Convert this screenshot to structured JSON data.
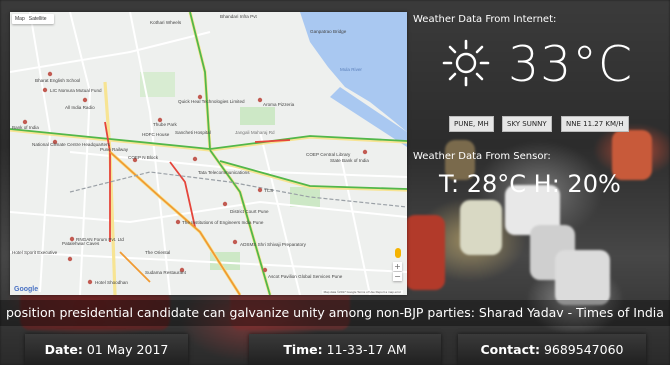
{
  "map": {
    "type_buttons": [
      "Map",
      "Satellite"
    ],
    "logo": "Google",
    "attribution": "Map data ©2017 Google   Terms of Use   Report a map error",
    "zoom_in": "+",
    "zoom_out": "−",
    "labels": [
      "Kothari Wheels",
      "Bhandari Infra Pvt",
      "Ganpatrao Bridge",
      "Mula River",
      "Bharat English School",
      "LIC Nomura Mutual Fund",
      "All India Radio",
      "Bank of India",
      "National Climate Centre Headquarters",
      "Quick Heal Technologies Limited",
      "Thube Park",
      "HDFC House",
      "Sancheti Hospital",
      "Aroma Pizzeria",
      "Jangali Maharaj Rd",
      "COEP Central Library",
      "State Bank of India",
      "COEP N Block",
      "Pune Railway",
      "Tata Telecommunications",
      "TCS",
      "District Court Pune",
      "The Institutions of Engineers India Pune",
      "RNGAN Forum Pvt. Ltd",
      "Hotel Sporit Executive",
      "Patalehwar Caves",
      "The Oriental",
      "ADSMS Shri Shivaji Preparatory",
      "Sudama Restaurant",
      "Hotel Shoodhan",
      "Ascot Pavilion Global Services Pune"
    ]
  },
  "weather": {
    "internet_title": "Weather Data From Internet:",
    "temperature": "33°C",
    "location": "PUNE, MH",
    "condition": "SKY SUNNY",
    "wind": "NNE 11.27 KM/H",
    "sensor_title": "Weather Data From Sensor:",
    "sensor_reading": "T: 28°C H: 20%"
  },
  "ticker": {
    "text": "position presidential candidate can galvanize unity among non-BJP parties: Sharad Yadav - Times of India"
  },
  "footer": {
    "date_label": "Date:",
    "date_value": "01 May 2017",
    "time_label": "Time:",
    "time_value": "11-33-17 AM",
    "contact_label": "Contact:",
    "contact_value": "9689547060"
  }
}
